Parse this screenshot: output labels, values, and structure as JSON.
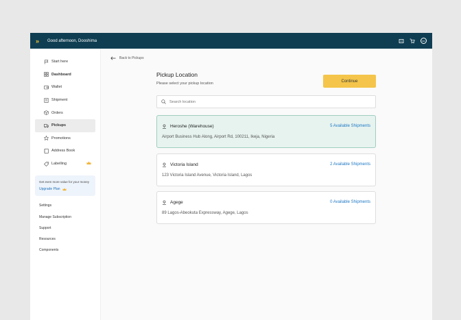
{
  "header": {
    "greeting": "Good afternoon, Dooshima",
    "logo_icon": "double-chevron-icon",
    "brand_color": "#0f3e52",
    "accent_color": "#f5c430",
    "avatar_initials": "DO"
  },
  "sidebar": {
    "items": [
      {
        "label": "Start here",
        "icon": "flag-icon"
      },
      {
        "label": "Dashboard",
        "icon": "dashboard-icon"
      },
      {
        "label": "Wallet",
        "icon": "wallet-icon"
      },
      {
        "label": "Shipment",
        "icon": "shipment-icon"
      },
      {
        "label": "Orders",
        "icon": "orders-icon"
      },
      {
        "label": "Pickups",
        "icon": "truck-icon"
      },
      {
        "label": "Promotions",
        "icon": "star-icon"
      },
      {
        "label": "Address Book",
        "icon": "address-book-icon"
      },
      {
        "label": "Labelling",
        "icon": "label-icon"
      }
    ],
    "active": "Pickups",
    "upgrade": {
      "text": "Get even more value for your money",
      "link": "Upgrade Plan"
    },
    "secondary": [
      "Settings",
      "Manage Subscription",
      "Support",
      "Resources",
      "Components"
    ]
  },
  "main": {
    "back_label": "Back to Pickups",
    "title": "Pickup Location",
    "subtitle": "Please select your pickup location",
    "continue_label": "Continue",
    "search_placeholder": "Search location",
    "locations": [
      {
        "name": "Heroshe (Warehouse)",
        "availability": "5 Available Shipments",
        "address": "Airport Business Hub Along, Airport Rd, 100211, Ikeja, Nigeria",
        "selected": true
      },
      {
        "name": "Victoria Island",
        "availability": "2 Available Shipments",
        "address": "123 Victoria Island Avenue, Victoria Island, Lagos",
        "selected": false
      },
      {
        "name": "Agege",
        "availability": "0 Available Shipments",
        "address": "89 Lagos-Abeokuta Expressway, Agege, Lagos",
        "selected": false
      }
    ]
  }
}
